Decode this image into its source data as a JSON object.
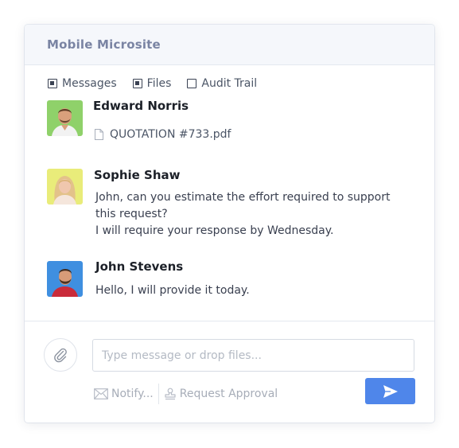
{
  "header": {
    "title": "Mobile Microsite"
  },
  "filters": [
    {
      "label": "Messages",
      "checked": true
    },
    {
      "label": "Files",
      "checked": true
    },
    {
      "label": "Audit Trail",
      "checked": false
    }
  ],
  "messages": [
    {
      "author": "Edward Norris",
      "attachment": "QUOTATION #733.pdf"
    },
    {
      "author": "Sophie Shaw",
      "lines": [
        "John, can you estimate the effort required to support",
        "this request?",
        "I will require your response by Wednesday."
      ]
    },
    {
      "author": "John Stevens",
      "lines": [
        "Hello, I will provide it today."
      ]
    }
  ],
  "composer": {
    "placeholder": "Type message or drop files...",
    "notify_label": "Notify...",
    "request_approval_label": "Request Approval"
  },
  "colors": {
    "accent": "#4f86ea",
    "header_bg": "#f5f7fb",
    "title": "#7a84a3"
  },
  "icons": [
    "paperclip-icon",
    "file-icon",
    "envelope-icon",
    "stamp-icon",
    "send-icon"
  ]
}
